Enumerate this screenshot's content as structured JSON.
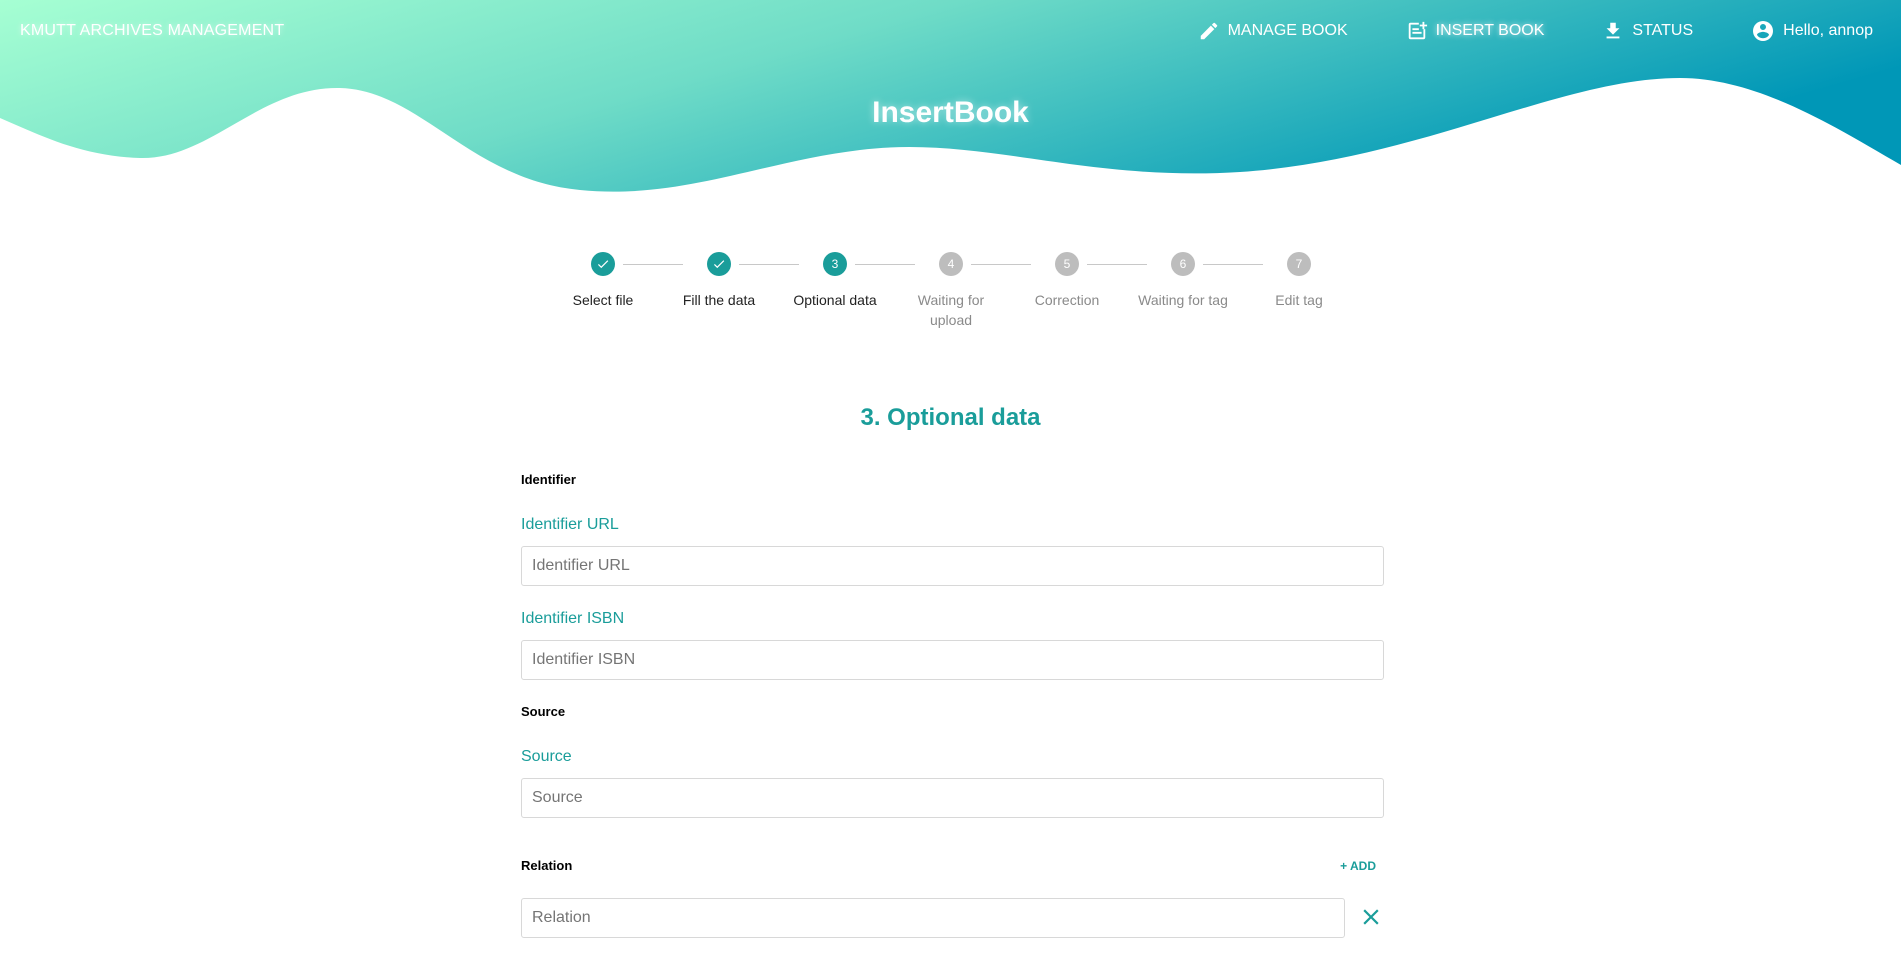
{
  "header": {
    "brand": "KMUTT ARCHIVES MANAGEMENT",
    "title": "InsertBook",
    "nav": [
      {
        "label": "MANAGE BOOK",
        "icon": "pencil-icon"
      },
      {
        "label": "INSERT BOOK",
        "icon": "note-add-icon",
        "active": true
      },
      {
        "label": "STATUS",
        "icon": "download-icon"
      },
      {
        "label": "Hello, annop",
        "icon": "account-circle-icon"
      }
    ]
  },
  "stepper": {
    "steps": [
      {
        "number": "",
        "label": "Select file",
        "state": "done"
      },
      {
        "number": "",
        "label": "Fill the data",
        "state": "done"
      },
      {
        "number": "3",
        "label": "Optional data",
        "state": "current"
      },
      {
        "number": "4",
        "label": "Waiting for upload",
        "state": "todo"
      },
      {
        "number": "5",
        "label": "Correction",
        "state": "todo"
      },
      {
        "number": "6",
        "label": "Waiting for tag",
        "state": "todo"
      },
      {
        "number": "7",
        "label": "Edit tag",
        "state": "todo"
      }
    ]
  },
  "form": {
    "section_title": "3. Optional data",
    "identifier": {
      "group_label": "Identifier",
      "url_label": "Identifier URL",
      "url_placeholder": "Identifier URL",
      "isbn_label": "Identifier ISBN",
      "isbn_placeholder": "Identifier ISBN"
    },
    "source": {
      "group_label": "Source",
      "label": "Source",
      "placeholder": "Source"
    },
    "relation": {
      "group_label": "Relation",
      "add_label": "+ ADD",
      "placeholder": "Relation"
    }
  },
  "colors": {
    "accent": "#1a9d9a",
    "wave_start": "#a6ffd3",
    "wave_end": "#0097b7",
    "step_inactive": "#bdbdbd"
  }
}
